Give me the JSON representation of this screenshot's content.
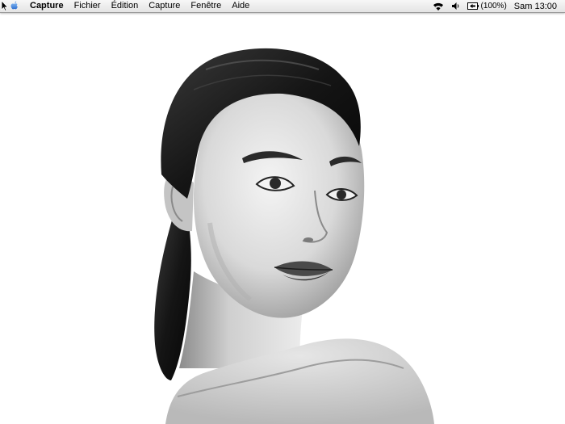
{
  "menubar": {
    "apple_menu": "apple-icon",
    "items": [
      "Capture",
      "Fichier",
      "Édition",
      "Capture",
      "Fenêtre",
      "Aide"
    ],
    "status": {
      "wifi": "wifi-icon",
      "volume": "volume-icon",
      "battery_label": "(100%)",
      "clock": "Sam 13:00"
    }
  },
  "desktop": {
    "wallpaper": "black-and-white portrait photograph"
  },
  "colors": {
    "menubar_top": "#f7f7f7",
    "menubar_bottom": "#e4e4e4",
    "apple_blue": "#3b7fd9",
    "background": "#ffffff"
  }
}
